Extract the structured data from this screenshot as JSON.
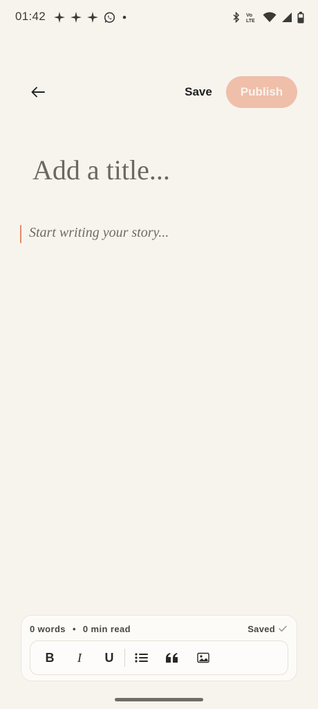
{
  "status_bar": {
    "time": "01:42",
    "left_icons": [
      "sparkle-icon",
      "sparkle-icon",
      "sparkle-icon",
      "whatsapp-icon",
      "dot-icon"
    ],
    "right_icons": [
      "bluetooth-icon",
      "volte-icon",
      "wifi-icon",
      "signal-icon",
      "battery-icon"
    ],
    "volte_label_top": "Vo",
    "volte_label_bottom": "LTE"
  },
  "toolbar": {
    "back_icon": "arrow-left-icon",
    "save_label": "Save",
    "publish_label": "Publish"
  },
  "editor": {
    "title_placeholder": "Add a title...",
    "body_placeholder": "Start writing your story..."
  },
  "footer": {
    "word_count": "0 words",
    "separator": "•",
    "read_time": "0 min read",
    "saved_label": "Saved",
    "saved_icon": "check-icon"
  },
  "format_bar": {
    "bold": "B",
    "italic": "I",
    "underline": "U",
    "list_icon": "bullet-list-icon",
    "quote_icon": "quote-icon",
    "image_icon": "image-icon"
  },
  "colors": {
    "background": "#f7f4ee",
    "accent": "#efbfaa",
    "cursor": "#e38a6a"
  }
}
